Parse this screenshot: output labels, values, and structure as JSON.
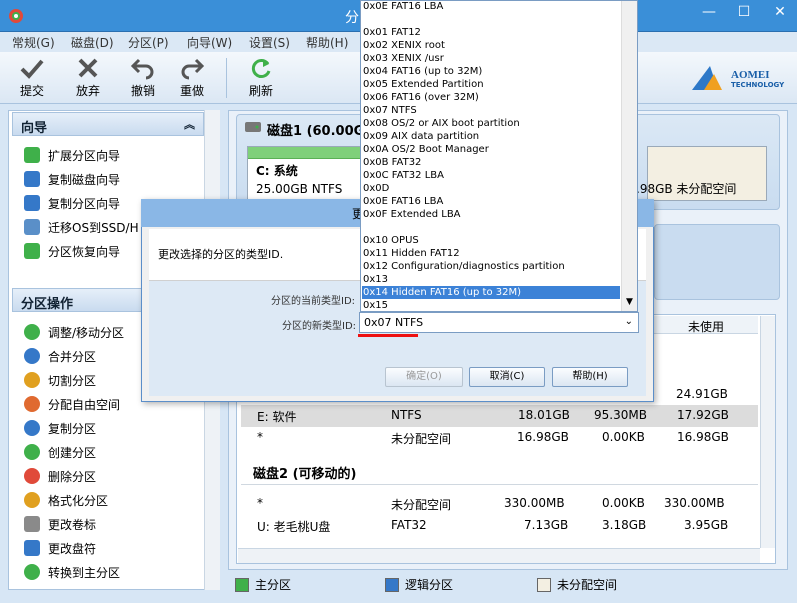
{
  "window": {
    "title": "分",
    "min": "—",
    "max": "☐",
    "close": "✕"
  },
  "menu": [
    "常规(G)",
    "磁盘(D)",
    "分区(P)",
    "向导(W)",
    "设置(S)",
    "帮助(H)"
  ],
  "toolbar": [
    "提交",
    "放弃",
    "撤销",
    "重做",
    "刷新"
  ],
  "brand": {
    "name": "AOMEI",
    "sub": "TECHNOLOGY"
  },
  "wizard": {
    "title": "向导",
    "items": [
      "扩展分区向导",
      "复制磁盘向导",
      "复制分区向导",
      "迁移OS到SSD/H",
      "分区恢复向导"
    ]
  },
  "ops": {
    "title": "分区操作",
    "items": [
      "调整/移动分区",
      "合并分区",
      "切割分区",
      "分配自由空间",
      "复制分区",
      "创建分区",
      "删除分区",
      "格式化分区",
      "更改卷标",
      "更改盘符",
      "转换到主分区"
    ]
  },
  "disk1": {
    "title": "磁盘1 (60.00GB",
    "c_label": "C: 系统",
    "c_info": "25.00GB NTFS",
    "unalloc": ".98GB 未分配空间"
  },
  "table": {
    "col_unused": "未使用",
    "row_partial": "24.91GB",
    "rows": [
      {
        "name": "E: 软件",
        "fs": "NTFS",
        "cap": "18.01GB",
        "used": "95.30MB",
        "free": "17.92GB"
      },
      {
        "name": "*",
        "fs": "未分配空间",
        "cap": "16.98GB",
        "used": "0.00KB",
        "free": "16.98GB"
      }
    ],
    "disk2_title": "磁盘2 (可移动的)",
    "rows2": [
      {
        "name": "*",
        "fs": "未分配空间",
        "cap": "330.00MB",
        "used": "0.00KB",
        "free": "330.00MB"
      },
      {
        "name": "U: 老毛桃U盘",
        "fs": "FAT32",
        "cap": "7.13GB",
        "used": "3.18GB",
        "free": "3.95GB"
      }
    ]
  },
  "legend": [
    "主分区",
    "逻辑分区",
    "未分配空间"
  ],
  "dialog": {
    "title_partial": "更",
    "desc": "更改选择的分区的类型ID.",
    "current_label": "分区的当前类型ID:",
    "new_label": "分区的新类型ID:",
    "selected": "0x07 NTFS",
    "ok": "确定(O)",
    "cancel": "取消(C)",
    "help": "帮助(H)"
  },
  "dropdown": [
    "0x0E FAT16 LBA",
    "",
    "0x01 FAT12",
    "0x02 XENIX root",
    "0x03 XENIX /usr",
    "0x04 FAT16 (up to 32M)",
    "0x05 Extended Partition",
    "0x06 FAT16 (over 32M)",
    "0x07 NTFS",
    "0x08 OS/2 or AIX boot partition",
    "0x09 AIX data partition",
    "0x0A OS/2 Boot Manager",
    "0x0B FAT32",
    "0x0C FAT32 LBA",
    "0x0D",
    "0x0E FAT16 LBA",
    "0x0F Extended LBA",
    "",
    "0x10 OPUS",
    "0x11 Hidden FAT12",
    "0x12 Configuration/diagnostics partition",
    "0x13",
    "0x14 Hidden FAT16 (up to 32M)",
    "0x15"
  ],
  "dropdown_selected_index": 22,
  "colors": {
    "accent": "#3a8fd8",
    "selection": "#3c82d7",
    "underline": "#e11111",
    "primary_green": "#3fb04a",
    "logical_blue": "#3578c8",
    "unalloc_beige": "#f3efe2"
  }
}
